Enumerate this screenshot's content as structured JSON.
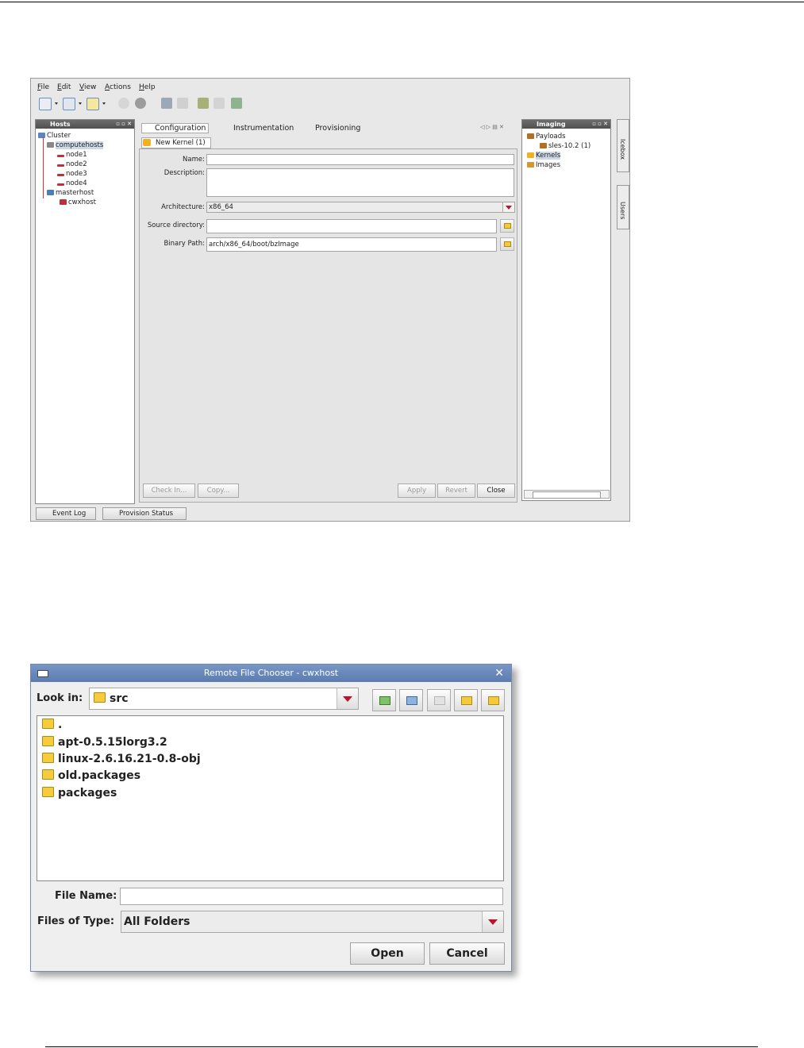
{
  "app": {
    "menu": [
      "File",
      "Edit",
      "View",
      "Actions",
      "Help"
    ],
    "hosts_panel": {
      "title": "Hosts",
      "tree": [
        "Cluster",
        "computehosts",
        "node1",
        "node2",
        "node3",
        "node4",
        "masterhost",
        "cwxhost"
      ]
    },
    "editor": {
      "tabs": [
        "Configuration",
        "Instrumentation",
        "Provisioning"
      ],
      "subtab": "New Kernel (1)",
      "labels": {
        "name": "Name:",
        "description": "Description:",
        "architecture": "Architecture:",
        "source_directory": "Source directory:",
        "binary_path": "Binary Path:"
      },
      "values": {
        "name": "",
        "description": "",
        "architecture": "x86_64",
        "source_directory": "",
        "binary_path": "arch/x86_64/boot/bzImage"
      },
      "buttons": {
        "check_in": "Check In...",
        "copy": "Copy...",
        "apply": "Apply",
        "revert": "Revert",
        "close": "Close"
      }
    },
    "imaging_panel": {
      "title": "Imaging",
      "tree": [
        "Payloads",
        "sles-10.2 (1)",
        "Kernels",
        "Images"
      ]
    },
    "side_tabs": [
      "Icebox",
      "Users"
    ],
    "bottom_tabs": [
      "Event Log",
      "Provision Status"
    ]
  },
  "dialog": {
    "title": "Remote File Chooser - cwxhost",
    "look_in_label": "Look in:",
    "look_in_value": "src",
    "files": [
      ".",
      "apt-0.5.15lorg3.2",
      "linux-2.6.16.21-0.8-obj",
      "old.packages",
      "packages"
    ],
    "file_name_label": "File Name:",
    "file_name_value": "",
    "files_of_type_label": "Files of Type:",
    "files_of_type_value": "All Folders",
    "open_label": "Open",
    "cancel_label": "Cancel"
  }
}
